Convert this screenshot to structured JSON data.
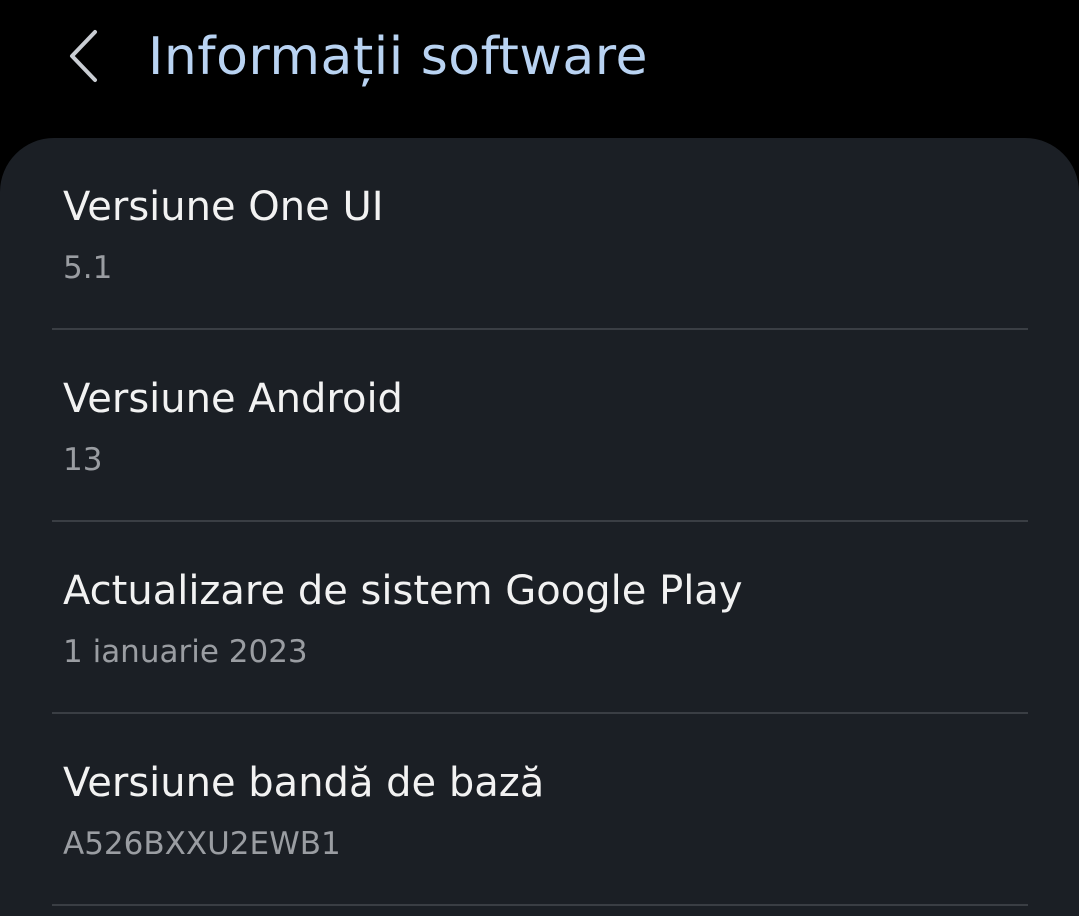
{
  "header": {
    "title": "Informații software",
    "back_icon": "chevron-left-icon"
  },
  "items": [
    {
      "title": "Versiune One UI",
      "value": "5.1"
    },
    {
      "title": "Versiune Android",
      "value": "13"
    },
    {
      "title": "Actualizare de sistem Google Play",
      "value": "1 ianuarie 2023"
    },
    {
      "title": "Versiune bandă de bază",
      "value": "A526BXXU2EWB1"
    }
  ],
  "colors": {
    "background": "#000000",
    "card": "#1b1f25",
    "title_accent": "#b9d3f2",
    "primary_text": "#f2f2f2",
    "secondary_text": "#9a9da2",
    "divider": "#3a3e44"
  }
}
